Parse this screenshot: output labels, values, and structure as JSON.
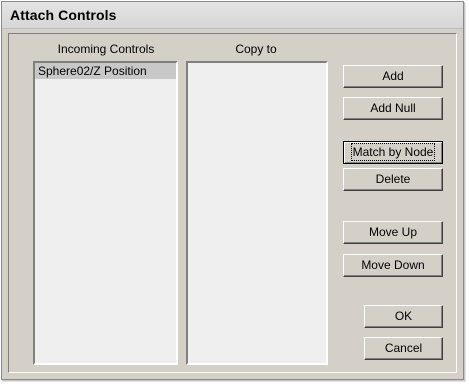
{
  "window": {
    "title": "Attach Controls"
  },
  "incoming": {
    "header": "Incoming Controls",
    "items": [
      "Sphere02/Z Position"
    ]
  },
  "copy_to": {
    "header": "Copy to",
    "items": []
  },
  "buttons": {
    "add": "Add",
    "add_null": "Add Null",
    "match_by_node": "Match by Node",
    "delete": "Delete",
    "move_up": "Move Up",
    "move_down": "Move Down",
    "ok": "OK",
    "cancel": "Cancel"
  },
  "colors": {
    "dialog_bg": "#d4d0c8",
    "list_bg": "#efefef",
    "selected_item": "#c8c8c8"
  }
}
